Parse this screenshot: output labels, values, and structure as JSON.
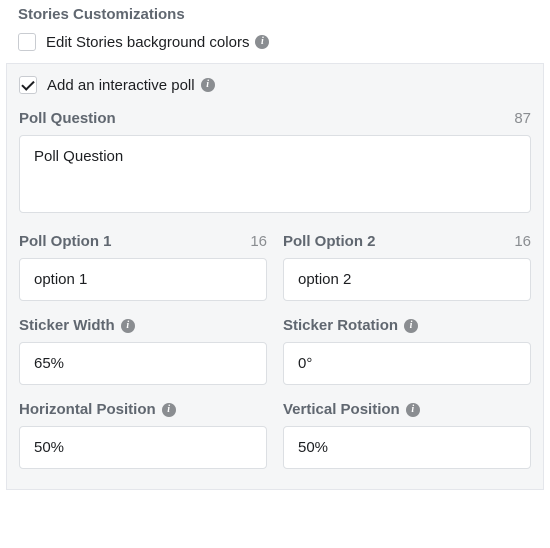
{
  "section_title": "Stories Customizations",
  "edit_bg": {
    "label": "Edit Stories background colors",
    "checked": false
  },
  "add_poll": {
    "label": "Add an interactive poll",
    "checked": true
  },
  "poll_question": {
    "label": "Poll Question",
    "value": "Poll Question",
    "counter": "87"
  },
  "option1": {
    "label": "Poll Option 1",
    "value": "option 1",
    "counter": "16"
  },
  "option2": {
    "label": "Poll Option 2",
    "value": "option 2",
    "counter": "16"
  },
  "sticker_width": {
    "label": "Sticker Width",
    "value": "65%"
  },
  "sticker_rotation": {
    "label": "Sticker Rotation",
    "value": "0°"
  },
  "h_position": {
    "label": "Horizontal Position",
    "value": "50%"
  },
  "v_position": {
    "label": "Vertical Position",
    "value": "50%"
  }
}
